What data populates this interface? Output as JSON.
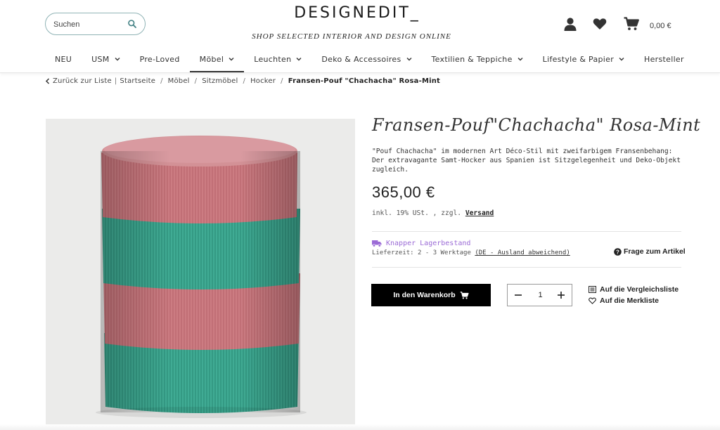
{
  "header": {
    "search_placeholder": "Suchen",
    "logo": "DESIGNEDIT_",
    "tagline": "SHOP SELECTED INTERIOR AND DESIGN ONLINE",
    "cart_total": "0,00 €",
    "icons": [
      "search-icon",
      "user-icon",
      "heart-icon",
      "cart-icon"
    ]
  },
  "nav": [
    {
      "label": "NEU",
      "dropdown": false
    },
    {
      "label": "USM",
      "dropdown": true
    },
    {
      "label": "Pre-Loved",
      "dropdown": false
    },
    {
      "label": "Möbel",
      "dropdown": true,
      "active": true
    },
    {
      "label": "Leuchten",
      "dropdown": true
    },
    {
      "label": "Deko & Accessoires",
      "dropdown": true
    },
    {
      "label": "Textilien & Teppiche",
      "dropdown": true
    },
    {
      "label": "Lifestyle & Papier",
      "dropdown": true
    },
    {
      "label": "Hersteller",
      "dropdown": false
    }
  ],
  "breadcrumb": {
    "back": "Zurück zur Liste",
    "divider": "|",
    "items": [
      "Startseite",
      "Möbel",
      "Sitzmöbel",
      "Hocker"
    ],
    "current": "Fransen-Pouf \"Chachacha\" Rosa-Mint"
  },
  "product": {
    "title": "Fransen-Pouf\"Chachacha\" Rosa-Mint",
    "description_lines": [
      "\"Pouf Chachacha\" im modernen Art Déco-Stil mit zweifarbigem Fransenbehang:",
      "Der extravagante Samt-Hocker aus Spanien ist Sitzgelegenheit und Deko-Objekt",
      "zugleich."
    ],
    "price": "365,00 €",
    "vat_text": "inkl.  19% USt. , zzgl. ",
    "shipping_link": "Versand",
    "stock_status": "Knapper Lagerbestand",
    "delivery_text": "Lieferzeit: 2 - 3 Werktage ",
    "delivery_link": "(DE - Ausland abweichend)",
    "question_label": "Frage zum Artikel",
    "cart_button": "In den Warenkorb",
    "quantity": "1",
    "compare_label": "Auf die Vergleichsliste",
    "wishlist_label": "Auf die Merkliste"
  },
  "colors": {
    "pink": "#c9777d",
    "mint": "#3aa58e",
    "stock": "#9b6bd6",
    "image_bg": "#ebebea",
    "button": "#000000"
  }
}
